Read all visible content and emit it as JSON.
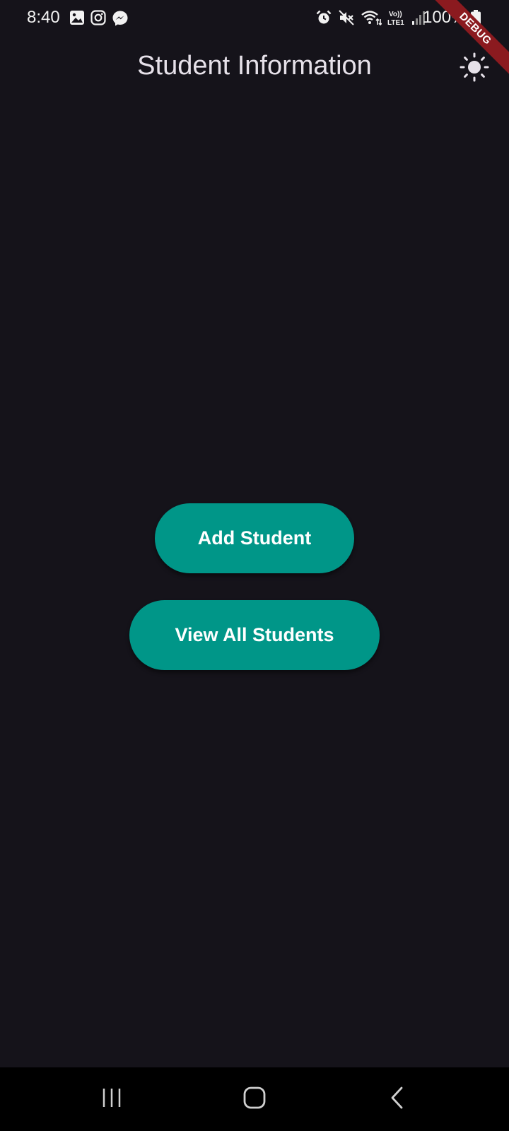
{
  "status_bar": {
    "time": "8:40",
    "battery_text": "100%",
    "left_icons": [
      "gallery-icon",
      "instagram-icon",
      "messenger-icon"
    ],
    "right_icons": [
      "alarm-icon",
      "mute-icon",
      "wifi-icon",
      "volte-lte-icon",
      "signal-icon",
      "battery-icon"
    ]
  },
  "debug_banner": {
    "label": "DEBUG"
  },
  "app_bar": {
    "title": "Student Information",
    "theme_toggle_icon": "sun-icon"
  },
  "actions": {
    "add_student_label": "Add Student",
    "view_all_label": "View All Students"
  },
  "nav_bar": {
    "recents_icon": "recents-icon",
    "home_icon": "home-icon",
    "back_icon": "back-icon"
  },
  "colors": {
    "background": "#15131a",
    "button": "#009688",
    "debug_banner": "#8b1a1f"
  }
}
